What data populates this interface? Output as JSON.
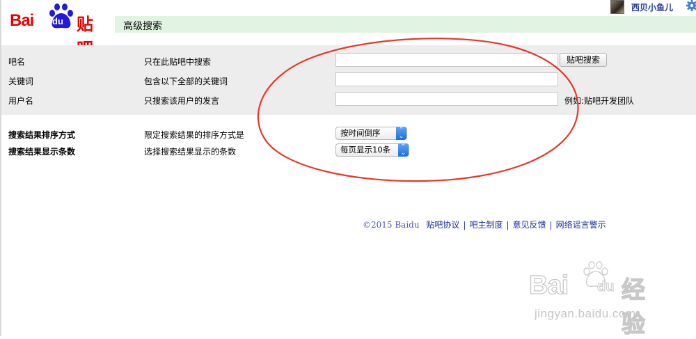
{
  "logo": {
    "text_bai": "Bai",
    "text_du": "du",
    "text_tieba": "贴吧",
    "brand_color": "#e10602"
  },
  "header": {
    "title": "高级搜索",
    "bar_color": "#e1f3e3"
  },
  "user": {
    "name": "西贝小鱼儿",
    "settings_icon": "gear-icon"
  },
  "search_panel": {
    "rows": [
      {
        "label": "吧名",
        "description": "只在此贴吧中搜索",
        "value": "",
        "button": "贴吧搜索"
      },
      {
        "label": "关键词",
        "description": "包含以下全部的关键词",
        "value": ""
      },
      {
        "label": "用户名",
        "description": "只搜索该用户的发言",
        "value": "",
        "hint": "例如:贴吧开发团队"
      }
    ]
  },
  "options": [
    {
      "label": "搜索结果排序方式",
      "description": "限定搜索结果的排序方式是",
      "selected": "按时间倒序"
    },
    {
      "label": "搜索结果显示条数",
      "description": "选择搜索结果显示的条数",
      "selected": "每页显示10条"
    }
  ],
  "footer": {
    "copyright": "©2015 Baidu",
    "links": [
      "贴吧协议",
      "吧主制度",
      "意见反馈",
      "网络谣言警示"
    ],
    "separator": "|"
  },
  "annotation": {
    "shape": "ellipse",
    "color": "#e8372c"
  },
  "watermark": {
    "bai": "Bai",
    "du": "du",
    "jingyan": "经验",
    "url": "jingyan.baidu.com"
  }
}
